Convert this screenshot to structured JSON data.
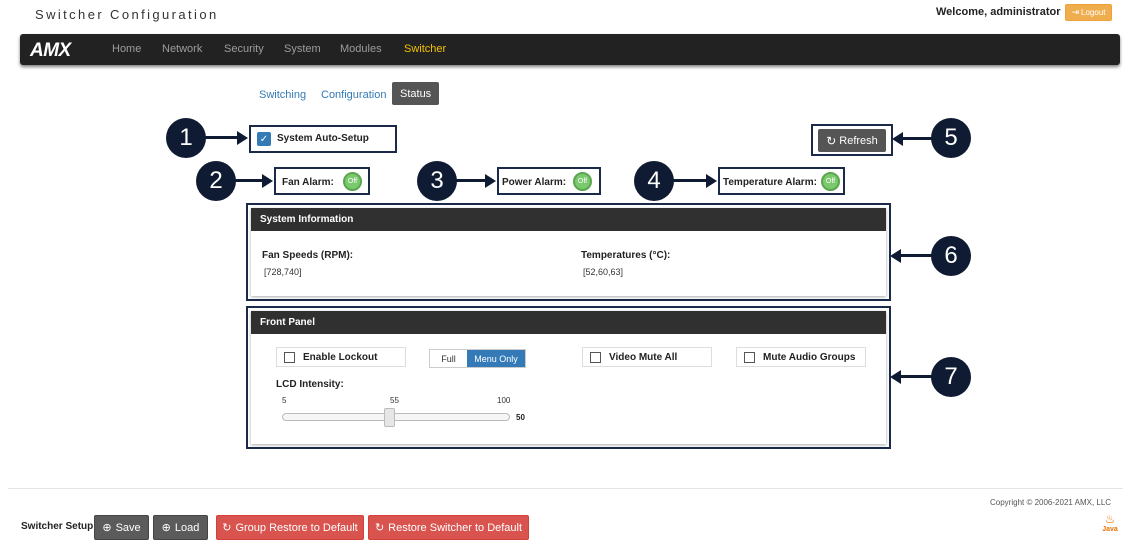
{
  "header": {
    "app_title": "Switcher Configuration",
    "welcome": "Welcome, administrator",
    "logout_label": "Logout"
  },
  "nav": {
    "logo": "AMX",
    "items": [
      "Home",
      "Network",
      "Security",
      "System",
      "Modules",
      "Switcher"
    ],
    "active": "Switcher"
  },
  "subtabs": [
    "Switching",
    "Configuration",
    "Status"
  ],
  "callouts": [
    "1",
    "2",
    "3",
    "4",
    "5",
    "6",
    "7"
  ],
  "status": {
    "auto_setup_label": "System Auto-Setup",
    "auto_setup_checked": true,
    "fan_alarm_label": "Fan Alarm:",
    "fan_alarm_state": "Off",
    "power_alarm_label": "Power Alarm:",
    "power_alarm_state": "Off",
    "temp_alarm_label": "Temperature Alarm:",
    "temp_alarm_state": "Off",
    "refresh_label": "Refresh"
  },
  "system_info": {
    "title": "System Information",
    "fan_label": "Fan Speeds (RPM):",
    "fan_value": "[728,740]",
    "temp_label": "Temperatures (°C):",
    "temp_value": "[52,60,63]"
  },
  "front_panel": {
    "title": "Front Panel",
    "enable_lockout": "Enable Lockout",
    "lockout_mode_full": "Full",
    "lockout_mode_menu": "Menu Only",
    "lockout_mode_selected": "Menu Only",
    "video_mute_all": "Video Mute All",
    "mute_audio_groups": "Mute Audio Groups",
    "lcd_label": "LCD Intensity:",
    "lcd_min": "5",
    "lcd_mid": "55",
    "lcd_max": "100",
    "lcd_value": "50"
  },
  "footer": {
    "copyright": "Copyright © 2006-2021 AMX, LLC",
    "setup_label": "Switcher Setup:",
    "save": "Save",
    "load": "Load",
    "group_restore": "Group Restore to Default",
    "restore_switcher": "Restore Switcher to Default",
    "java_label": "Java"
  },
  "colors": {
    "accent_blue": "#337ab7",
    "nav_bg": "#222222",
    "nav_active": "#f2c200",
    "toggle_green": "#7bc96f",
    "danger": "#d9534f",
    "callout_navy": "#0f1b33"
  }
}
